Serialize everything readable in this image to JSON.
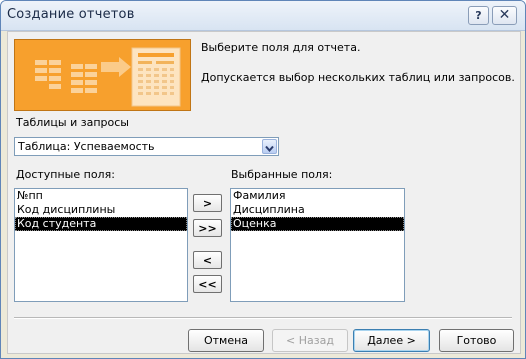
{
  "window": {
    "title": "Создание отчетов",
    "help_label": "?",
    "close_label": "✕"
  },
  "header": {
    "prompt": "Выберите поля для отчета.",
    "note": "Допускается выбор нескольких таблиц или запросов."
  },
  "tables": {
    "label": "Таблицы и запросы",
    "selected": "Таблица: Успеваемость"
  },
  "available": {
    "label": "Доступные поля:",
    "items": [
      "№пп",
      "Код дисциплины",
      "Код студента"
    ],
    "selected_index": 2
  },
  "chosen": {
    "label": "Выбранные поля:",
    "items": [
      "Фамилия",
      "Дисциплина",
      "Оценка"
    ],
    "selected_index": 2
  },
  "move_buttons": {
    "add_one": ">",
    "add_all": ">>",
    "remove_one": "<",
    "remove_all": "<<"
  },
  "footer": {
    "cancel": "Отмена",
    "back": "< Назад",
    "next": "Далее >",
    "finish": "Готово"
  },
  "colors": {
    "illustration_bg": "#f7a02d",
    "selection": "#000000"
  }
}
